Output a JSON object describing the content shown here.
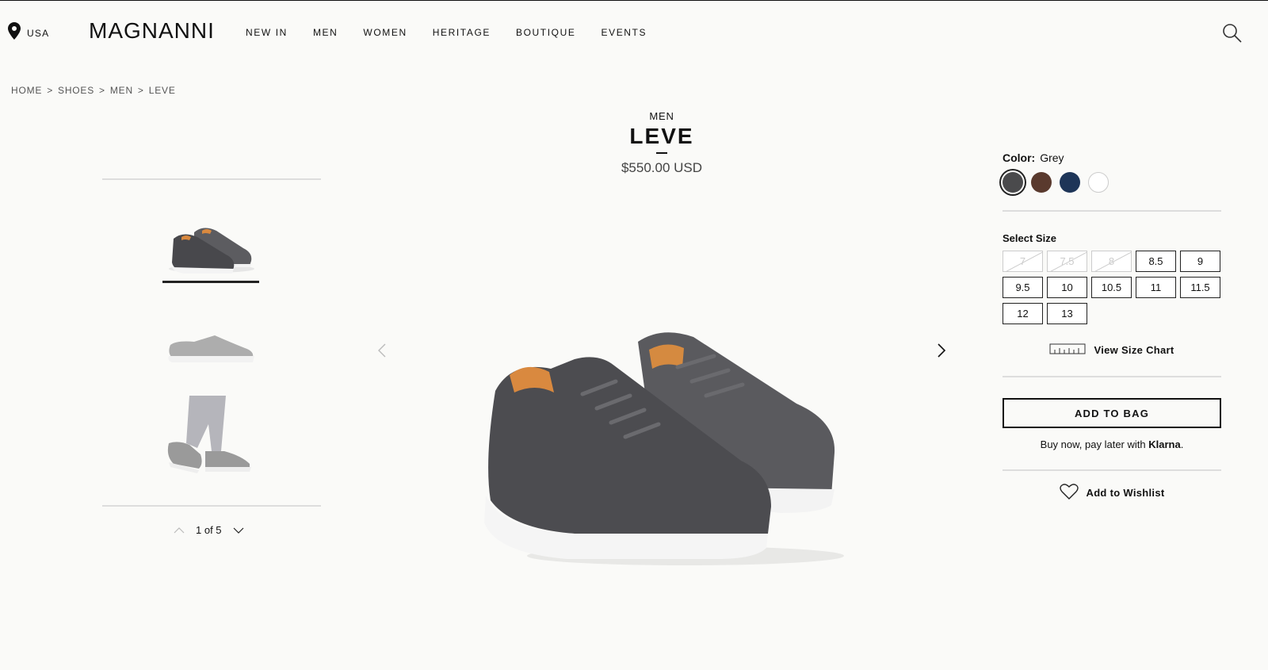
{
  "header": {
    "location": "USA",
    "logo": "MAGNANNI",
    "nav": [
      "NEW IN",
      "MEN",
      "WOMEN",
      "HERITAGE",
      "BOUTIQUE",
      "EVENTS"
    ],
    "icons": {
      "location": "map-pin-icon",
      "search": "search-icon"
    }
  },
  "breadcrumb": [
    "HOME",
    "SHOES",
    "MEN",
    "LEVE"
  ],
  "breadcrumb_separator": ">",
  "product": {
    "category": "MEN",
    "name": "LEVE",
    "price": "$550.00 USD"
  },
  "gallery": {
    "pager": "1 of 5"
  },
  "options": {
    "color_label": "Color:",
    "color_value": "Grey",
    "colors": [
      "#4a4a4c",
      "#5a3a2e",
      "#1e3558",
      "#ffffff"
    ],
    "size_label": "Select Size",
    "sizes": [
      {
        "label": "7",
        "available": false
      },
      {
        "label": "7.5",
        "available": false
      },
      {
        "label": "8",
        "available": false
      },
      {
        "label": "8.5",
        "available": true
      },
      {
        "label": "9",
        "available": true
      },
      {
        "label": "9.5",
        "available": true
      },
      {
        "label": "10",
        "available": true
      },
      {
        "label": "10.5",
        "available": true
      },
      {
        "label": "11",
        "available": true
      },
      {
        "label": "11.5",
        "available": true
      },
      {
        "label": "12",
        "available": true
      },
      {
        "label": "13",
        "available": true
      }
    ],
    "size_chart_link": "View Size Chart"
  },
  "actions": {
    "add_to_bag": "ADD TO BAG",
    "klarna_text": "Buy now, pay later with",
    "klarna_brand": "Klarna",
    "klarna_suffix": ".",
    "wishlist": "Add to Wishlist"
  }
}
